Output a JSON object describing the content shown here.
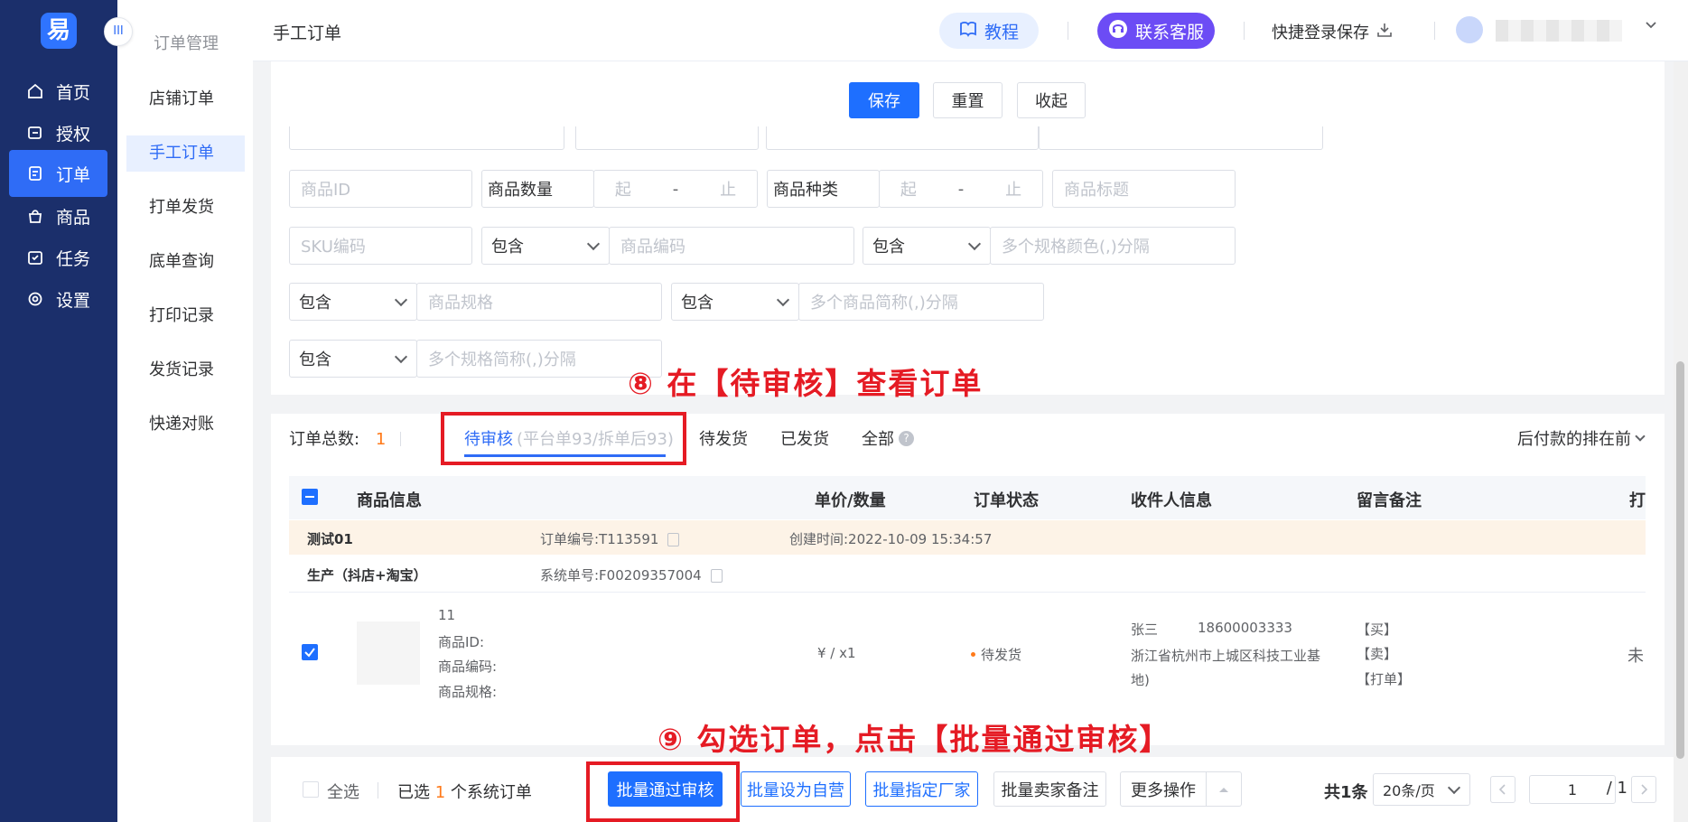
{
  "nav": {
    "logo": "易",
    "items": [
      {
        "label": "首页",
        "icon": "home-icon"
      },
      {
        "label": "授权",
        "icon": "key-icon"
      },
      {
        "label": "订单",
        "icon": "order-icon"
      },
      {
        "label": "商品",
        "icon": "bag-icon"
      },
      {
        "label": "任务",
        "icon": "task-icon"
      },
      {
        "label": "设置",
        "icon": "gear-icon"
      }
    ]
  },
  "subnav": {
    "collapse": "III",
    "title": "订单管理",
    "items": [
      "店铺订单",
      "手工订单",
      "打单发货",
      "底单查询",
      "打印记录",
      "发货记录",
      "快递对账"
    ]
  },
  "header": {
    "title": "手工订单",
    "tutorial": "教程",
    "support": "联系客服",
    "quick_login": "快捷登录保存"
  },
  "toolbar": {
    "save": "保存",
    "reset": "重置",
    "collapse": "收起"
  },
  "filters": {
    "product_id": "商品ID",
    "product_qty": "商品数量",
    "from": "起",
    "dash": "-",
    "to": "止",
    "product_kind": "商品种类",
    "product_title": "商品标题",
    "sku_code": "SKU编码",
    "contains": "包含",
    "product_code": "商品编码",
    "spec_color": "多个规格颜色(,)分隔",
    "product_spec": "商品规格",
    "product_abbr": "多个商品简称(,)分隔",
    "spec_abbr": "多个规格简称(,)分隔"
  },
  "annotations": {
    "step8": "⑧ 在【待审核】查看订单",
    "step9": "⑨ 勾选订单，点击【批量通过审核】"
  },
  "orders": {
    "total_label": "订单总数:",
    "total": "1",
    "tabs": {
      "pending_review": "待审核",
      "pending_review_sub": "(平台单93/拆单后93)",
      "pending_ship": "待发货",
      "shipped": "已发货",
      "all": "全部"
    },
    "sort": "后付款的排在前",
    "columns": [
      "商品信息",
      "单价/数量",
      "订单状态",
      "收件人信息",
      "留言备注",
      "打印"
    ],
    "row": {
      "shop": "测试01",
      "order_no": "订单编号:T113591",
      "created": "创建时间:2022-10-09 15:34:57",
      "source": "生产（抖店+淘宝）",
      "system_no": "系统单号:F00209357004",
      "product_name": "11",
      "product_id": "商品ID:",
      "product_code": "商品编码:",
      "product_spec": "商品规格:",
      "price_qty": "¥ / x1",
      "status": "待发货",
      "receiver_name": "张三",
      "receiver_phone": "18600003333",
      "address": "浙江省杭州市上城区科技工业基地)",
      "remark_buy": "【买】",
      "remark_sell": "【卖】",
      "remark_print": "【打单】",
      "print": "未"
    }
  },
  "footer": {
    "select_all": "全选",
    "selected_prefix": "已选",
    "selected_count": "1",
    "selected_suffix": "个系统订单",
    "batch_approve": "批量通过审核",
    "batch_self": "批量设为自营",
    "batch_vendor": "批量指定厂家",
    "batch_remark": "批量卖家备注",
    "more": "更多操作",
    "total": "共1条",
    "page_size": "20条/页",
    "page": "1",
    "page_total": "/ 1"
  },
  "colors": {
    "primary": "#1e6fff",
    "nav_bg": "#1b2f6b",
    "annotation": "#e51b24",
    "accent_orange": "#ff7a1a"
  }
}
